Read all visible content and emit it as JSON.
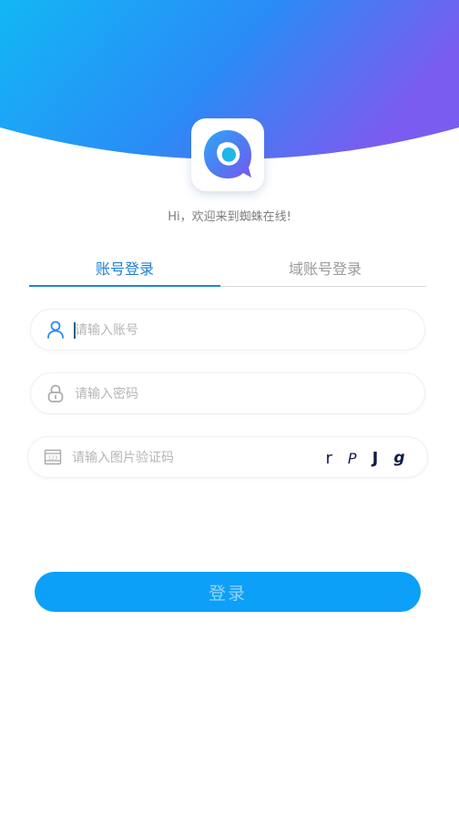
{
  "header": {
    "gradient_start": "#12b7f5",
    "gradient_mid": "#2a8cf6",
    "gradient_end": "#7b5cf0",
    "logo_icon": "q-chat-bubble-icon"
  },
  "welcome_text": "Hi，欢迎来到蜘蛛在线!",
  "tabs": [
    {
      "label": "账号登录",
      "active": true
    },
    {
      "label": "域账号登录",
      "active": false
    }
  ],
  "form": {
    "account": {
      "placeholder": "请输入账号",
      "value": "",
      "icon": "user-icon"
    },
    "password": {
      "placeholder": "请输入密码",
      "value": "",
      "icon": "lock-icon"
    },
    "captcha": {
      "placeholder": "请输入图片验证码",
      "value": "",
      "icon": "captcha-123-icon",
      "image_text": [
        "r",
        "P",
        "J",
        "g"
      ]
    }
  },
  "login_button": {
    "label": "登录",
    "color": "#0da0f8"
  },
  "accent_color": "#1b86e0"
}
